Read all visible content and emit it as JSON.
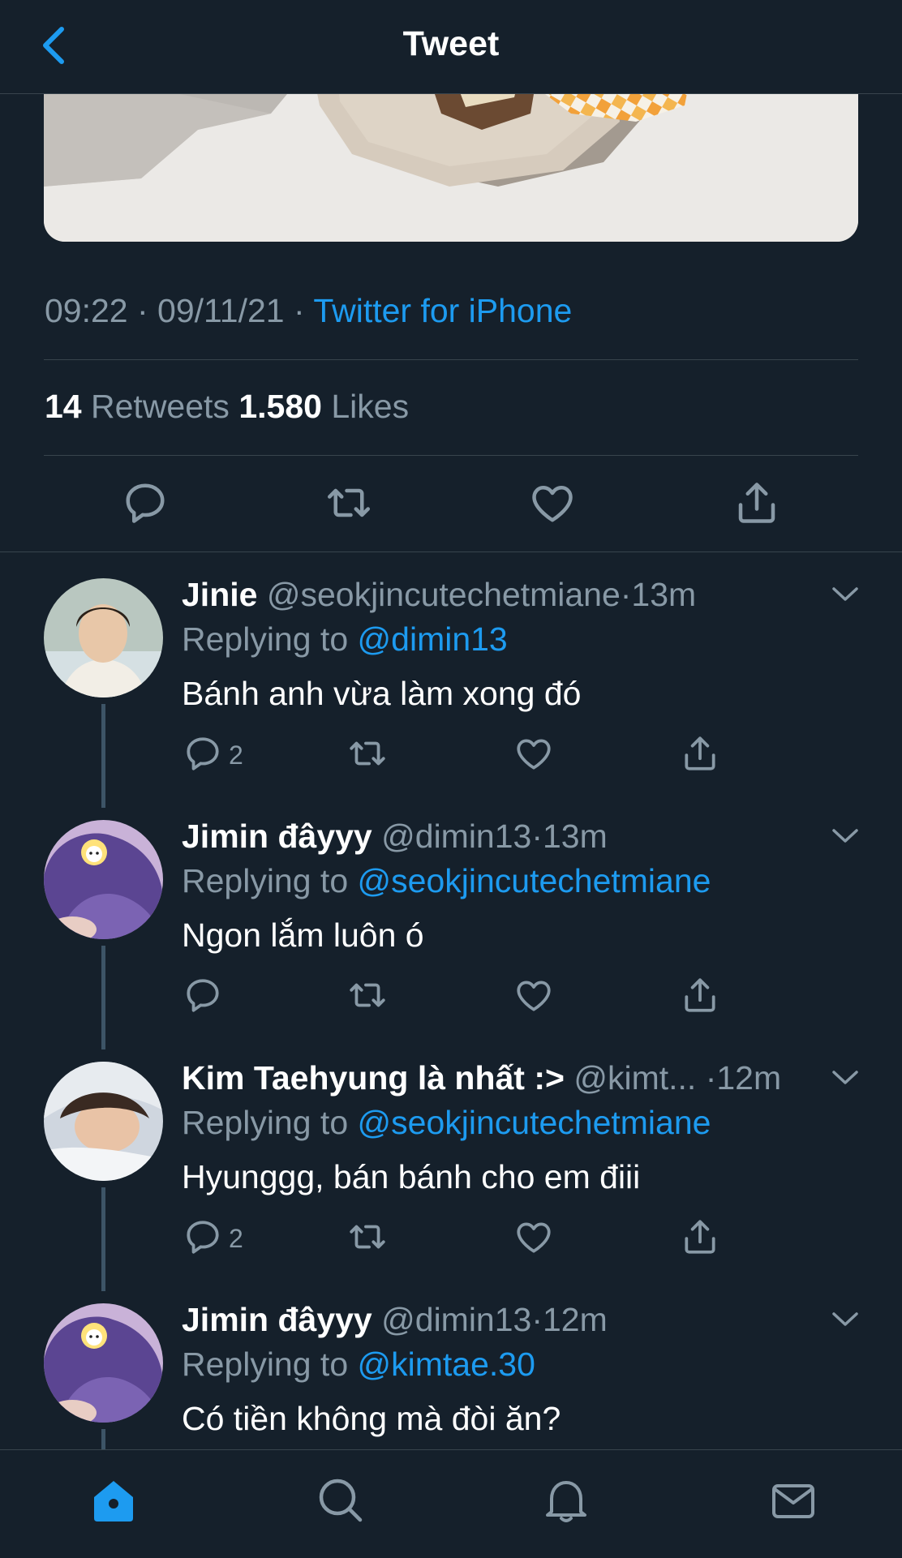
{
  "header": {
    "title": "Tweet",
    "back_icon": "chevron-left-icon"
  },
  "tweet": {
    "time": "09:22",
    "date": "09/11/21",
    "source": "Twitter for iPhone",
    "separator": " · ",
    "retweets_count": "14",
    "retweets_label": "Retweets",
    "likes_count": "1.580",
    "likes_label": "Likes",
    "actions": [
      "reply-icon",
      "retweet-icon",
      "like-icon",
      "share-icon"
    ]
  },
  "replies": [
    {
      "name": "Jinie",
      "handle": "@seokjincutechetmiane",
      "dot": "·",
      "time": "13m",
      "replying_prefix": "Replying to",
      "replying_to": "@dimin13",
      "text": "Bánh anh vừa làm xong đó",
      "reply_count": "2"
    },
    {
      "name": "Jimin đâyyy",
      "handle": "@dimin13",
      "dot": "·",
      "time": "13m",
      "replying_prefix": "Replying to",
      "replying_to": "@seokjincutechetmiane",
      "text": "Ngon lắm luôn ó",
      "reply_count": ""
    },
    {
      "name": "Kim Taehyung là nhất :>",
      "handle": "@kimt...",
      "dot": "·",
      "time": "12m",
      "replying_prefix": "Replying to",
      "replying_to": "@seokjincutechetmiane",
      "text": "Hyunggg, bán bánh cho em điii",
      "reply_count": "2"
    },
    {
      "name": "Jimin đâyyy",
      "handle": "@dimin13",
      "dot": "·",
      "time": "12m",
      "replying_prefix": "Replying to",
      "replying_to": "@kimtae.30",
      "text": "Có tiền không mà đòi ăn?",
      "reply_count": ""
    }
  ],
  "tabbar": {
    "items": [
      "home-icon",
      "search-icon",
      "notifications-icon",
      "messages-icon"
    ]
  },
  "colors": {
    "background": "#15202b",
    "accent": "#1d9bf0",
    "secondary_text": "#8899a6",
    "divider": "#38444d"
  }
}
